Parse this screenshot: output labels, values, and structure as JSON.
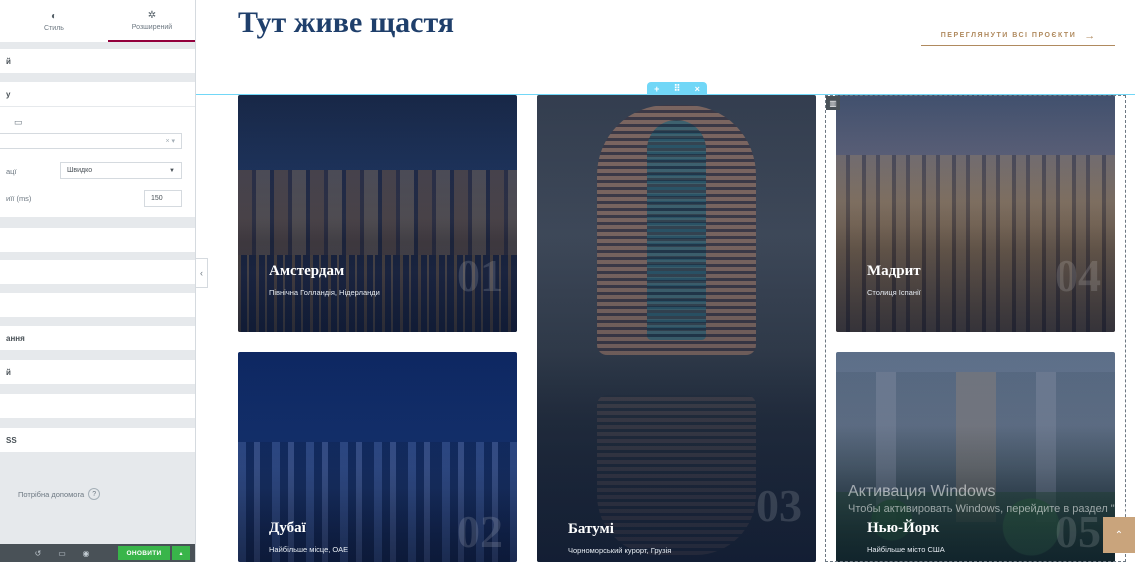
{
  "panel": {
    "tabs": [
      {
        "label": "Стиль",
        "icon": "contrast-icon"
      },
      {
        "label": "Розширений",
        "icon": "gear-icon"
      }
    ],
    "rows": [
      "й",
      "у",
      "ацї",
      "иїї (ms)",
      "ання",
      "й",
      "SS"
    ],
    "field_clear": "× ▾",
    "animation_value": "Швидко",
    "delay_value": "150",
    "help_label": "Потрібна допомога",
    "help_icon": "?",
    "update_label": "ОНОВИТИ",
    "update_arrow": "▴",
    "collapse_icon": "‹"
  },
  "page": {
    "title": "Тут живе щастя",
    "view_all": "ПЕРЕГЛЯНУТИ ВСІ ПРОЄКТИ",
    "view_all_arrow": "→",
    "section_handle": [
      "+",
      "⠿",
      "×"
    ]
  },
  "cards": [
    {
      "name": "Амстердам",
      "desc": "Північна Голландія, Нідерланди",
      "num": "01"
    },
    {
      "name": "Батумі",
      "desc": "Чорноморський курорт, Грузія",
      "num": "03"
    },
    {
      "name": "Мадрит",
      "desc": "Столиця Іспанії",
      "num": "04"
    },
    {
      "name": "Дубаї",
      "desc": "Найбільше місце, ОАЕ",
      "num": "02"
    },
    {
      "name": "Нью-Йорк",
      "desc": "Найбільше місто США",
      "num": "05"
    }
  ],
  "watermark": {
    "line1": "Активация Windows",
    "line2": "Чтобы активировать Windows, перейдите в раздел \"Параметры\"."
  },
  "back_to_top": "⌃",
  "colors": {
    "title": "#1f3f6b",
    "accent": "#b08a5e",
    "update": "#39b54a",
    "outline": "#71d7f7"
  }
}
